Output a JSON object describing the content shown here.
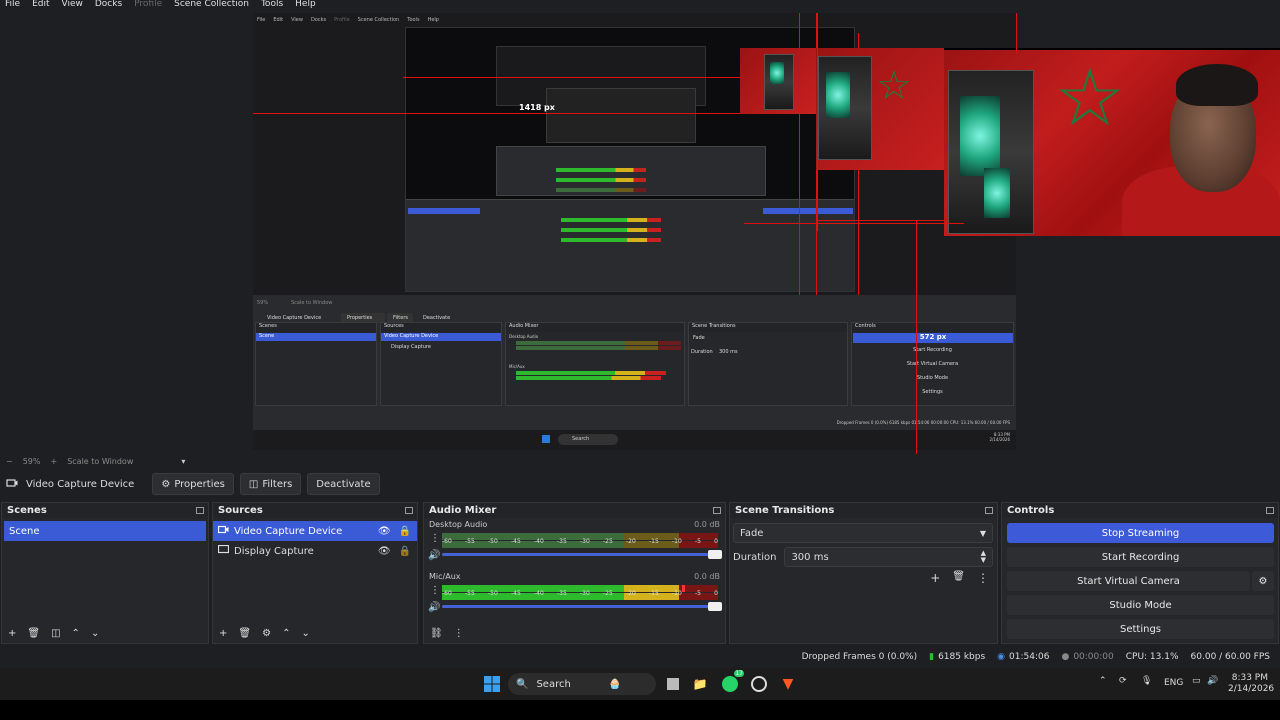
{
  "menubar": {
    "items": [
      "File",
      "Edit",
      "View",
      "Docks",
      "Profile",
      "Scene Collection",
      "Tools",
      "Help"
    ],
    "disabled": [
      "Profile"
    ]
  },
  "preview": {
    "measure_label_1": "1418 px",
    "measure_label_2": "572 px",
    "nested_menu": [
      "File",
      "Edit",
      "View",
      "Docks",
      "Profile",
      "Scene Collection",
      "Tools",
      "Help"
    ],
    "nested_zoom": "59%",
    "nested_scale": "Scale to Window",
    "nested_source": "Video Capture Device",
    "nested_buttons": [
      "Properties",
      "Filters",
      "Deactivate"
    ],
    "nested_docks": [
      "Scenes",
      "Sources",
      "Audio Mixer",
      "Scene Transitions",
      "Controls"
    ],
    "nested_scene": "Scene",
    "nested_sources": [
      "Video Capture Device",
      "Display Capture"
    ],
    "nested_mixer": [
      "Desktop Audio",
      "Mic/Aux"
    ],
    "nested_transition": "Fade",
    "nested_duration_label": "Duration",
    "nested_duration": "300 ms",
    "nested_controls": [
      "Start Recording",
      "Start Virtual Camera",
      "Studio Mode",
      "Settings"
    ],
    "nested_status": "Dropped Frames 0 (0.0%)   6185 kbps   01:54:06   00:00:00   CPU: 13.1%   60.00 / 60.00 FPS",
    "nested_search": "Search",
    "nested_time": "8:33 PM",
    "nested_date": "2/14/2026"
  },
  "zoom": {
    "level": "59%",
    "mode": "Scale to Window"
  },
  "toolbar": {
    "source_name": "Video Capture Device",
    "properties": "Properties",
    "filters": "Filters",
    "deactivate": "Deactivate"
  },
  "scenes": {
    "title": "Scenes",
    "items": [
      "Scene"
    ]
  },
  "sources": {
    "title": "Sources",
    "items": [
      "Video Capture Device",
      "Display Capture"
    ]
  },
  "mixer": {
    "title": "Audio Mixer",
    "channels": [
      {
        "name": "Desktop Audio",
        "db": "0.0 dB",
        "level": 0
      },
      {
        "name": "Mic/Aux",
        "db": "0.0 dB",
        "level": 0.88
      }
    ],
    "ticks": [
      "-60",
      "-55",
      "-50",
      "-45",
      "-40",
      "-35",
      "-30",
      "-25",
      "-20",
      "-15",
      "-10",
      "-5",
      "0"
    ]
  },
  "transitions": {
    "title": "Scene Transitions",
    "selected": "Fade",
    "duration_label": "Duration",
    "duration": "300 ms"
  },
  "controls": {
    "title": "Controls",
    "stop_streaming": "Stop Streaming",
    "start_recording": "Start Recording",
    "start_virtual_camera": "Start Virtual Camera",
    "studio_mode": "Studio Mode",
    "settings": "Settings"
  },
  "status": {
    "dropped": "Dropped Frames 0 (0.0%)",
    "bitrate": "6185 kbps",
    "stream_time": "01:54:06",
    "rec_time": "00:00:00",
    "cpu": "CPU: 13.1%",
    "fps": "60.00 / 60.00 FPS"
  },
  "taskbar": {
    "search": "Search",
    "lang": "ENG",
    "time": "8:33 PM",
    "date": "2/14/2026",
    "whatsapp_badge": "17"
  },
  "colors": {
    "accent": "#3b5bd6",
    "red_guide": "#e01010",
    "meter_green": "#2dbb2d",
    "meter_yellow": "#d4b21c",
    "meter_red": "#c92020"
  }
}
